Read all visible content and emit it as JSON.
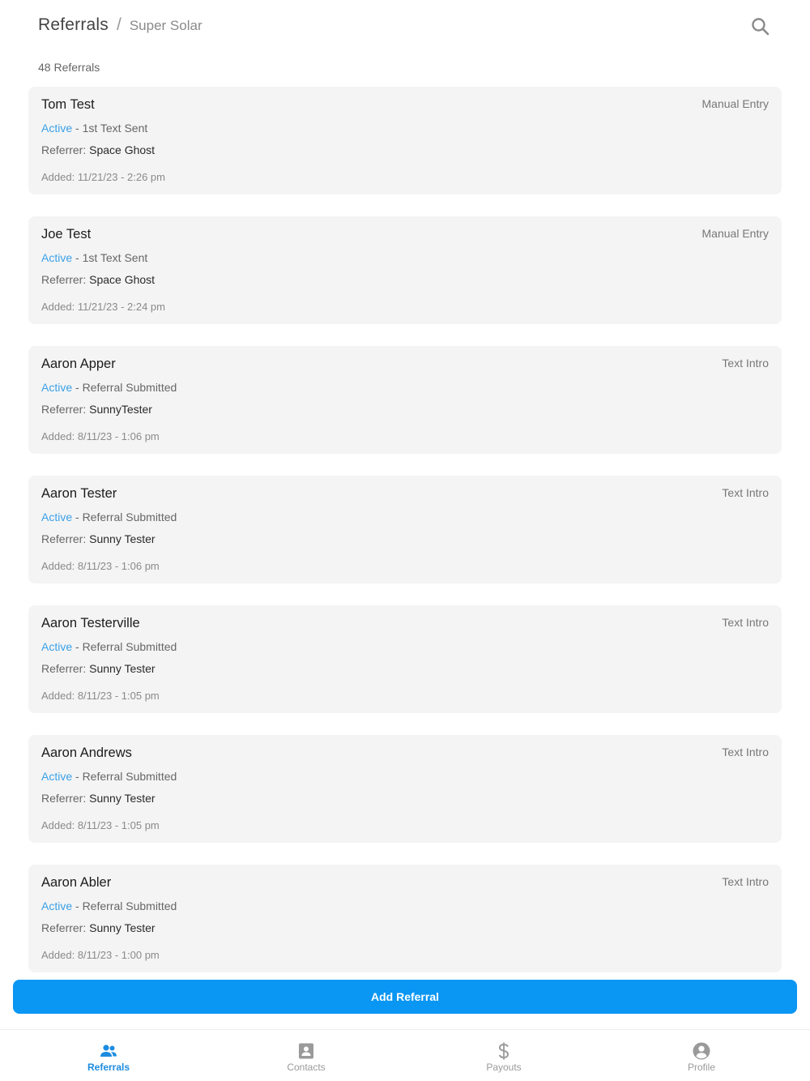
{
  "header": {
    "title": "Referrals",
    "separator": "/",
    "subtitle": "Super Solar",
    "search_icon": "search-icon"
  },
  "summary": {
    "count_label": "48 Referrals"
  },
  "colors": {
    "accent": "#0a96f3",
    "status_active": "#3aa0e8",
    "card_bg": "#f4f4f4"
  },
  "referrals": [
    {
      "name": "Tom Test",
      "source": "Manual Entry",
      "state": "Active",
      "stage": " - 1st Text Sent",
      "referrer_label": "Referrer: ",
      "referrer": "Space Ghost",
      "added": "Added: 11/21/23 - 2:26 pm"
    },
    {
      "name": "Joe Test",
      "source": "Manual Entry",
      "state": "Active",
      "stage": " - 1st Text Sent",
      "referrer_label": "Referrer: ",
      "referrer": "Space Ghost",
      "added": "Added: 11/21/23 - 2:24 pm"
    },
    {
      "name": "Aaron Apper",
      "source": "Text Intro",
      "state": "Active",
      "stage": " - Referral Submitted",
      "referrer_label": "Referrer: ",
      "referrer": "SunnyTester",
      "added": "Added: 8/11/23 - 1:06 pm"
    },
    {
      "name": "Aaron Tester",
      "source": "Text Intro",
      "state": "Active",
      "stage": " - Referral Submitted",
      "referrer_label": "Referrer: ",
      "referrer": "Sunny Tester",
      "added": "Added: 8/11/23 - 1:06 pm"
    },
    {
      "name": "Aaron Testerville",
      "source": "Text Intro",
      "state": "Active",
      "stage": " - Referral Submitted",
      "referrer_label": "Referrer: ",
      "referrer": "Sunny Tester",
      "added": "Added: 8/11/23 - 1:05 pm"
    },
    {
      "name": "Aaron Andrews",
      "source": "Text Intro",
      "state": "Active",
      "stage": " - Referral Submitted",
      "referrer_label": "Referrer: ",
      "referrer": "Sunny Tester",
      "added": "Added: 8/11/23 - 1:05 pm"
    },
    {
      "name": "Aaron Abler",
      "source": "Text Intro",
      "state": "Active",
      "stage": " - Referral Submitted",
      "referrer_label": "Referrer: ",
      "referrer": "Sunny Tester",
      "added": "Added: 8/11/23 - 1:00 pm"
    }
  ],
  "actions": {
    "add_referral": "Add Referral"
  },
  "tabbar": {
    "tabs": [
      {
        "label": "Referrals",
        "icon": "people-icon",
        "active": true
      },
      {
        "label": "Contacts",
        "icon": "contact-card-icon",
        "active": false
      },
      {
        "label": "Payouts",
        "icon": "dollar-icon",
        "active": false
      },
      {
        "label": "Profile",
        "icon": "user-circle-icon",
        "active": false
      }
    ]
  }
}
